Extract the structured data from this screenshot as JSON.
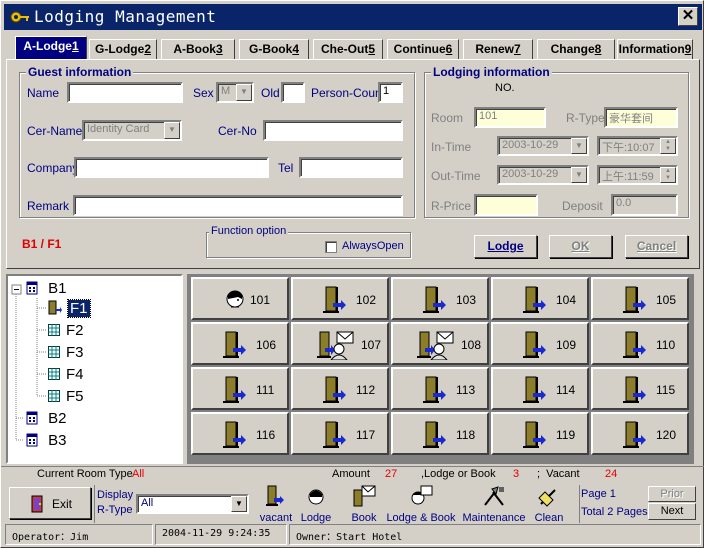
{
  "window": {
    "title": "Lodging Management",
    "close": "✕"
  },
  "tabs": [
    {
      "label": "A-Lodge",
      "key": "1"
    },
    {
      "label": "G-Lodge",
      "key": "2"
    },
    {
      "label": "A-Book",
      "key": "3"
    },
    {
      "label": "G-Book",
      "key": "4"
    },
    {
      "label": "Che-Out",
      "key": "5"
    },
    {
      "label": "Continue",
      "key": "6"
    },
    {
      "label": "Renew",
      "key": "7"
    },
    {
      "label": "Change",
      "key": "8"
    },
    {
      "label": "Information",
      "key": "9"
    }
  ],
  "guest": {
    "title": "Guest information",
    "name_label": "Name",
    "name_value": "",
    "sex_label": "Sex",
    "sex_value": "M",
    "old_label": "Old",
    "old_value": "",
    "count_label": "Person-Count",
    "count_value": "1",
    "cername_label": "Cer-Name",
    "cername_value": "Identity Card",
    "cerno_label": "Cer-No",
    "cerno_value": "",
    "company_label": "Company",
    "company_value": "",
    "tel_label": "Tel",
    "tel_value": "",
    "remark_label": "Remark",
    "remark_value": ""
  },
  "location": "B1 / F1",
  "function_option": {
    "title": "Function option",
    "always_open": "AlwaysOpen"
  },
  "lodging": {
    "title": "Lodging information",
    "no_label": "NO.",
    "room_label": "Room",
    "room_value": "101",
    "rtype_label": "R-Type",
    "rtype_value": "豪华套间",
    "intime_label": "In-Time",
    "intime_date": "2003-10-29",
    "intime_time": "下午:10:07",
    "outtime_label": "Out-Time",
    "outtime_date": "2003-10-29",
    "outtime_time": "上午:11:59",
    "rprice_label": "R-Price",
    "rprice_value": "",
    "deposit_label": "Deposit",
    "deposit_value": "0.0"
  },
  "actions": {
    "lodge": "Lodge",
    "ok": "OK",
    "cancel": "Cancel"
  },
  "tree": {
    "b1": "B1",
    "floors": [
      "F1",
      "F2",
      "F3",
      "F4",
      "F5"
    ],
    "b2": "B2",
    "b3": "B3"
  },
  "rooms": [
    {
      "num": "101",
      "state": "lodge"
    },
    {
      "num": "102",
      "state": "vacant"
    },
    {
      "num": "103",
      "state": "vacant"
    },
    {
      "num": "104",
      "state": "vacant"
    },
    {
      "num": "105",
      "state": "vacant"
    },
    {
      "num": "106",
      "state": "vacant"
    },
    {
      "num": "107",
      "state": "lodge-book"
    },
    {
      "num": "108",
      "state": "lodge-book"
    },
    {
      "num": "109",
      "state": "vacant"
    },
    {
      "num": "110",
      "state": "vacant"
    },
    {
      "num": "111",
      "state": "vacant"
    },
    {
      "num": "112",
      "state": "vacant"
    },
    {
      "num": "113",
      "state": "vacant"
    },
    {
      "num": "114",
      "state": "vacant"
    },
    {
      "num": "115",
      "state": "vacant"
    },
    {
      "num": "116",
      "state": "vacant"
    },
    {
      "num": "117",
      "state": "vacant"
    },
    {
      "num": "118",
      "state": "vacant"
    },
    {
      "num": "119",
      "state": "vacant"
    },
    {
      "num": "120",
      "state": "vacant"
    }
  ],
  "summary": {
    "room_type_label": "Current Room Type",
    "room_type_value": "All",
    "amount_label": "Amount",
    "amount_value": "27",
    "lodge_book_label": ",Lodge or Book",
    "lodge_book_value": "3",
    "vacant_label": ";  Vacant",
    "vacant_value": "24"
  },
  "bottom": {
    "exit": "Exit",
    "display_label": "Display",
    "rtype_label": "R-Type",
    "rtype_value": "All",
    "legend": [
      "vacant",
      "Lodge",
      "Book",
      "Lodge & Book",
      "Maintenance",
      "Clean"
    ],
    "page": "Page 1",
    "total_pages": "Total 2 Pages",
    "prior": "Prior",
    "next": "Next"
  },
  "statusbar": {
    "operator": "Operator：Jim",
    "datetime": "2004-11-29 9:24:35",
    "owner": "Owner：Start Hotel"
  },
  "colors": {
    "title_bar": "#0a246a",
    "label": "#000080",
    "accent_red": "#e00000",
    "door": "#8b7d2a",
    "arrow": "#1a2ad0"
  }
}
